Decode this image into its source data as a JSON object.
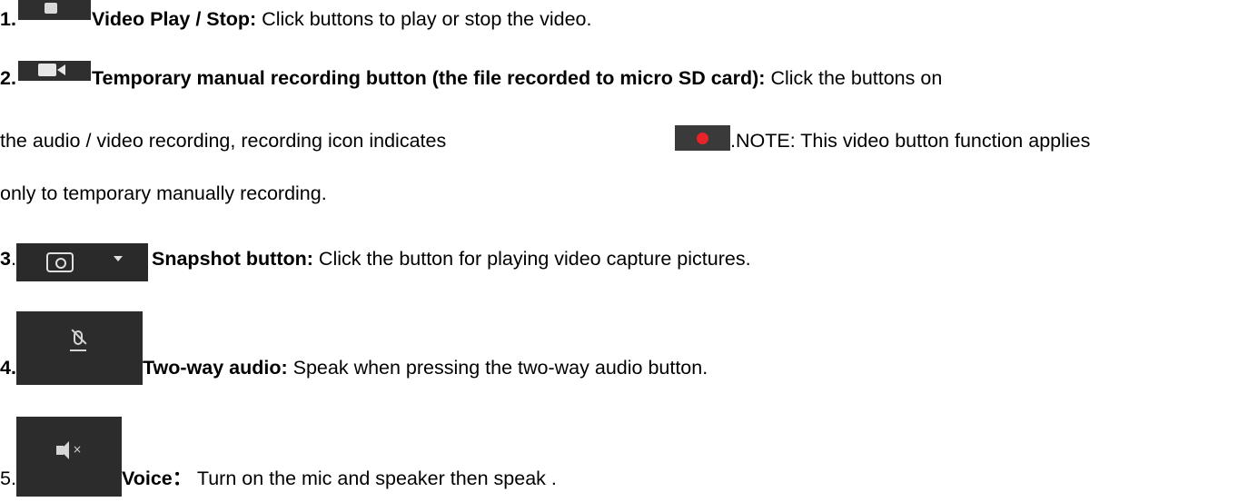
{
  "items": [
    {
      "number": "1.",
      "title": "Video Play / Stop:",
      "text": " Click buttons to play or stop the video.",
      "icon": "stop-icon"
    },
    {
      "number": "2.",
      "title": "Temporary manual recording button (the file recorded to micro SD card):",
      "text_line1_end": " Click the buttons on",
      "text_line2a": "the audio / video recording, recording icon indicates",
      "text_line2b": ".NOTE: This video button function applies",
      "text_line3": "only to temporary manually recording.",
      "icon": "record-camera-icon",
      "inline_icon": "recording-dot-icon",
      "inline_icon_color": "#e8232a"
    },
    {
      "number": "3",
      "dot": ".",
      "title": "Snapshot button:",
      "text": " Click the button for playing video capture pictures.",
      "icon": "camera-snapshot-icon"
    },
    {
      "number": "4.",
      "title": "Two-way audio:",
      "text": " Speak when pressing the two-way audio button.",
      "icon": "mic-mute-icon"
    },
    {
      "number": "5.",
      "title": "Voice：",
      "text": " Turn on the mic and speaker then speak .",
      "icon": "speaker-mute-icon"
    }
  ]
}
